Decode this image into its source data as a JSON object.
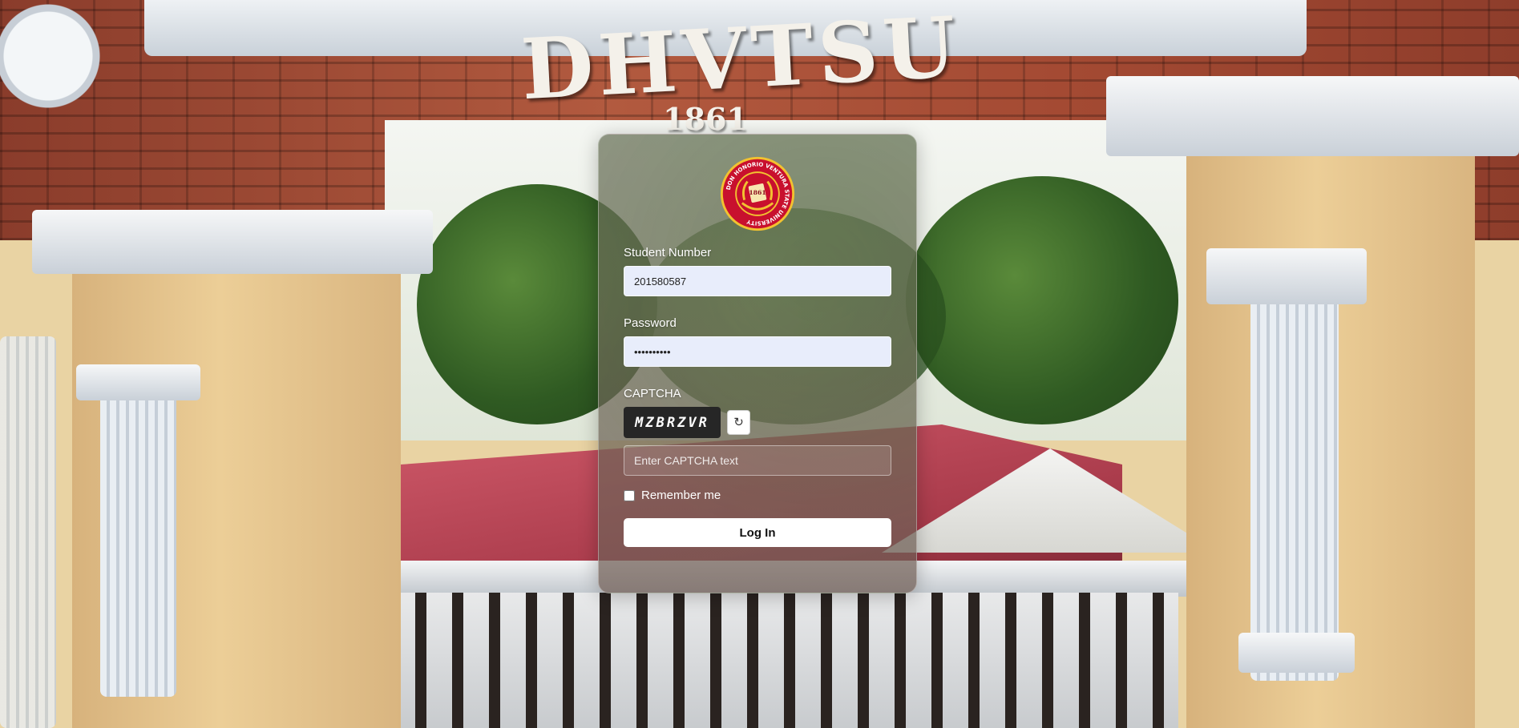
{
  "background": {
    "sign_text": "DHVTSU",
    "sign_year": "1861"
  },
  "logo": {
    "icon": "university-seal-icon",
    "ring_text": "DON HONORIO VENTURA STATE UNIVERSITY",
    "center_year": "1861",
    "colors": {
      "ring": "#c8102e",
      "gold": "#f2c230"
    }
  },
  "form": {
    "student_number_label": "Student Number",
    "student_number_value": "201580587",
    "password_label": "Password",
    "password_value": "••••••••••",
    "captcha_label": "CAPTCHA",
    "captcha_text": "MZBRZVR",
    "refresh_icon": "↻",
    "captcha_placeholder": "Enter CAPTCHA text",
    "remember_label": "Remember me",
    "submit_label": "Log In"
  }
}
